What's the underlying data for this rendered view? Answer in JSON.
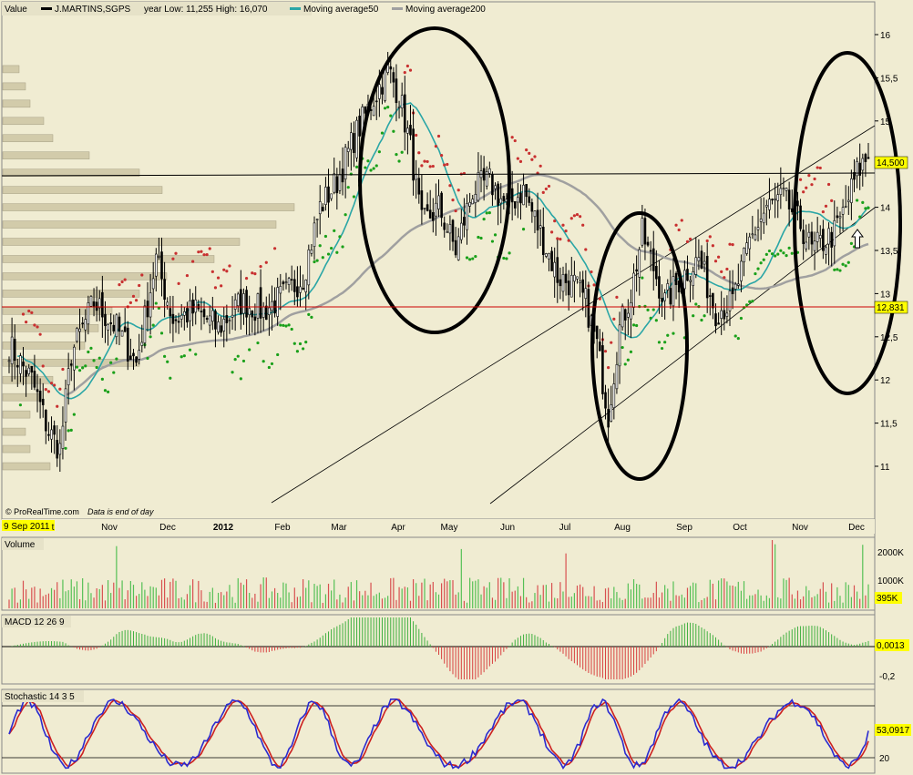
{
  "header": {
    "value_label": "Value",
    "symbol": "J.MARTINS,SGPS",
    "year_range": "year Low: 11,255 High: 16,070",
    "ma50_label": "Moving average50",
    "ma200_label": "Moving average200"
  },
  "footer": {
    "source": "© ProRealTime.com",
    "note": "Data is end of day",
    "date_badge": "9 Sep 2011"
  },
  "colors": {
    "background": "#f0ecd2",
    "candle_up": "#ffffff",
    "candle_down": "#000000",
    "ma50": "#2aa6a6",
    "ma200": "#a0a0a0",
    "sar_up": "#1aa01a",
    "sar_down": "#c83030",
    "price_badge": "#ffff00",
    "hline_red": "#cc0000",
    "stoch_k": "#2a2ad0",
    "stoch_d": "#cc2020"
  },
  "price_panel": {
    "y_ticks": [
      "16",
      "15,5",
      "15",
      "14,5",
      "14",
      "13,5",
      "13",
      "12,5",
      "12",
      "11,5",
      "11"
    ],
    "last_price_badge": "14,500",
    "hline_price_badge": "12,831"
  },
  "x_axis": {
    "labels": [
      "t",
      "Nov",
      "Dec",
      "2012",
      "Feb",
      "Mar",
      "Apr",
      "May",
      "Jun",
      "Jul",
      "Aug",
      "Sep",
      "Oct",
      "Nov",
      "Dec"
    ]
  },
  "volume_panel": {
    "title": "Volume",
    "ticks": [
      "2000K",
      "1000K"
    ],
    "last_badge": "395K"
  },
  "macd_panel": {
    "title": "MACD 12 26 9",
    "last_badge": "0,0013",
    "tick": "-0,2"
  },
  "stoch_panel": {
    "title": "Stochastic 14 3 5",
    "last_badge": "53,0917",
    "tick": "20"
  },
  "chart_data": {
    "type": "candlestick",
    "title": "J.MARTINS,SGPS",
    "period": "Sep 2011 – Dec 2012",
    "ylim": [
      10.7,
      16.3
    ],
    "grid": false,
    "year_low": 11.255,
    "year_high": 16.07,
    "last_close": 14.5,
    "horizontal_level": 12.831,
    "monthly_close": [
      {
        "x": "Oct",
        "y": 12.5
      },
      {
        "x": "Nov",
        "y": 12.8
      },
      {
        "x": "Dec",
        "y": 12.7
      },
      {
        "x": "Jan",
        "y": 12.9
      },
      {
        "x": "Feb",
        "y": 12.8
      },
      {
        "x": "Mar",
        "y": 13.5
      },
      {
        "x": "Apr",
        "y": 15.3
      },
      {
        "x": "May",
        "y": 14.0
      },
      {
        "x": "Jun",
        "y": 14.1
      },
      {
        "x": "Jul",
        "y": 13.1
      },
      {
        "x": "Aug",
        "y": 13.6
      },
      {
        "x": "Sep",
        "y": 13.2
      },
      {
        "x": "Oct",
        "y": 14.0
      },
      {
        "x": "Nov",
        "y": 13.6
      },
      {
        "x": "Dec",
        "y": 14.5
      }
    ],
    "series": [
      {
        "name": "Moving average50"
      },
      {
        "name": "Moving average200"
      }
    ]
  }
}
